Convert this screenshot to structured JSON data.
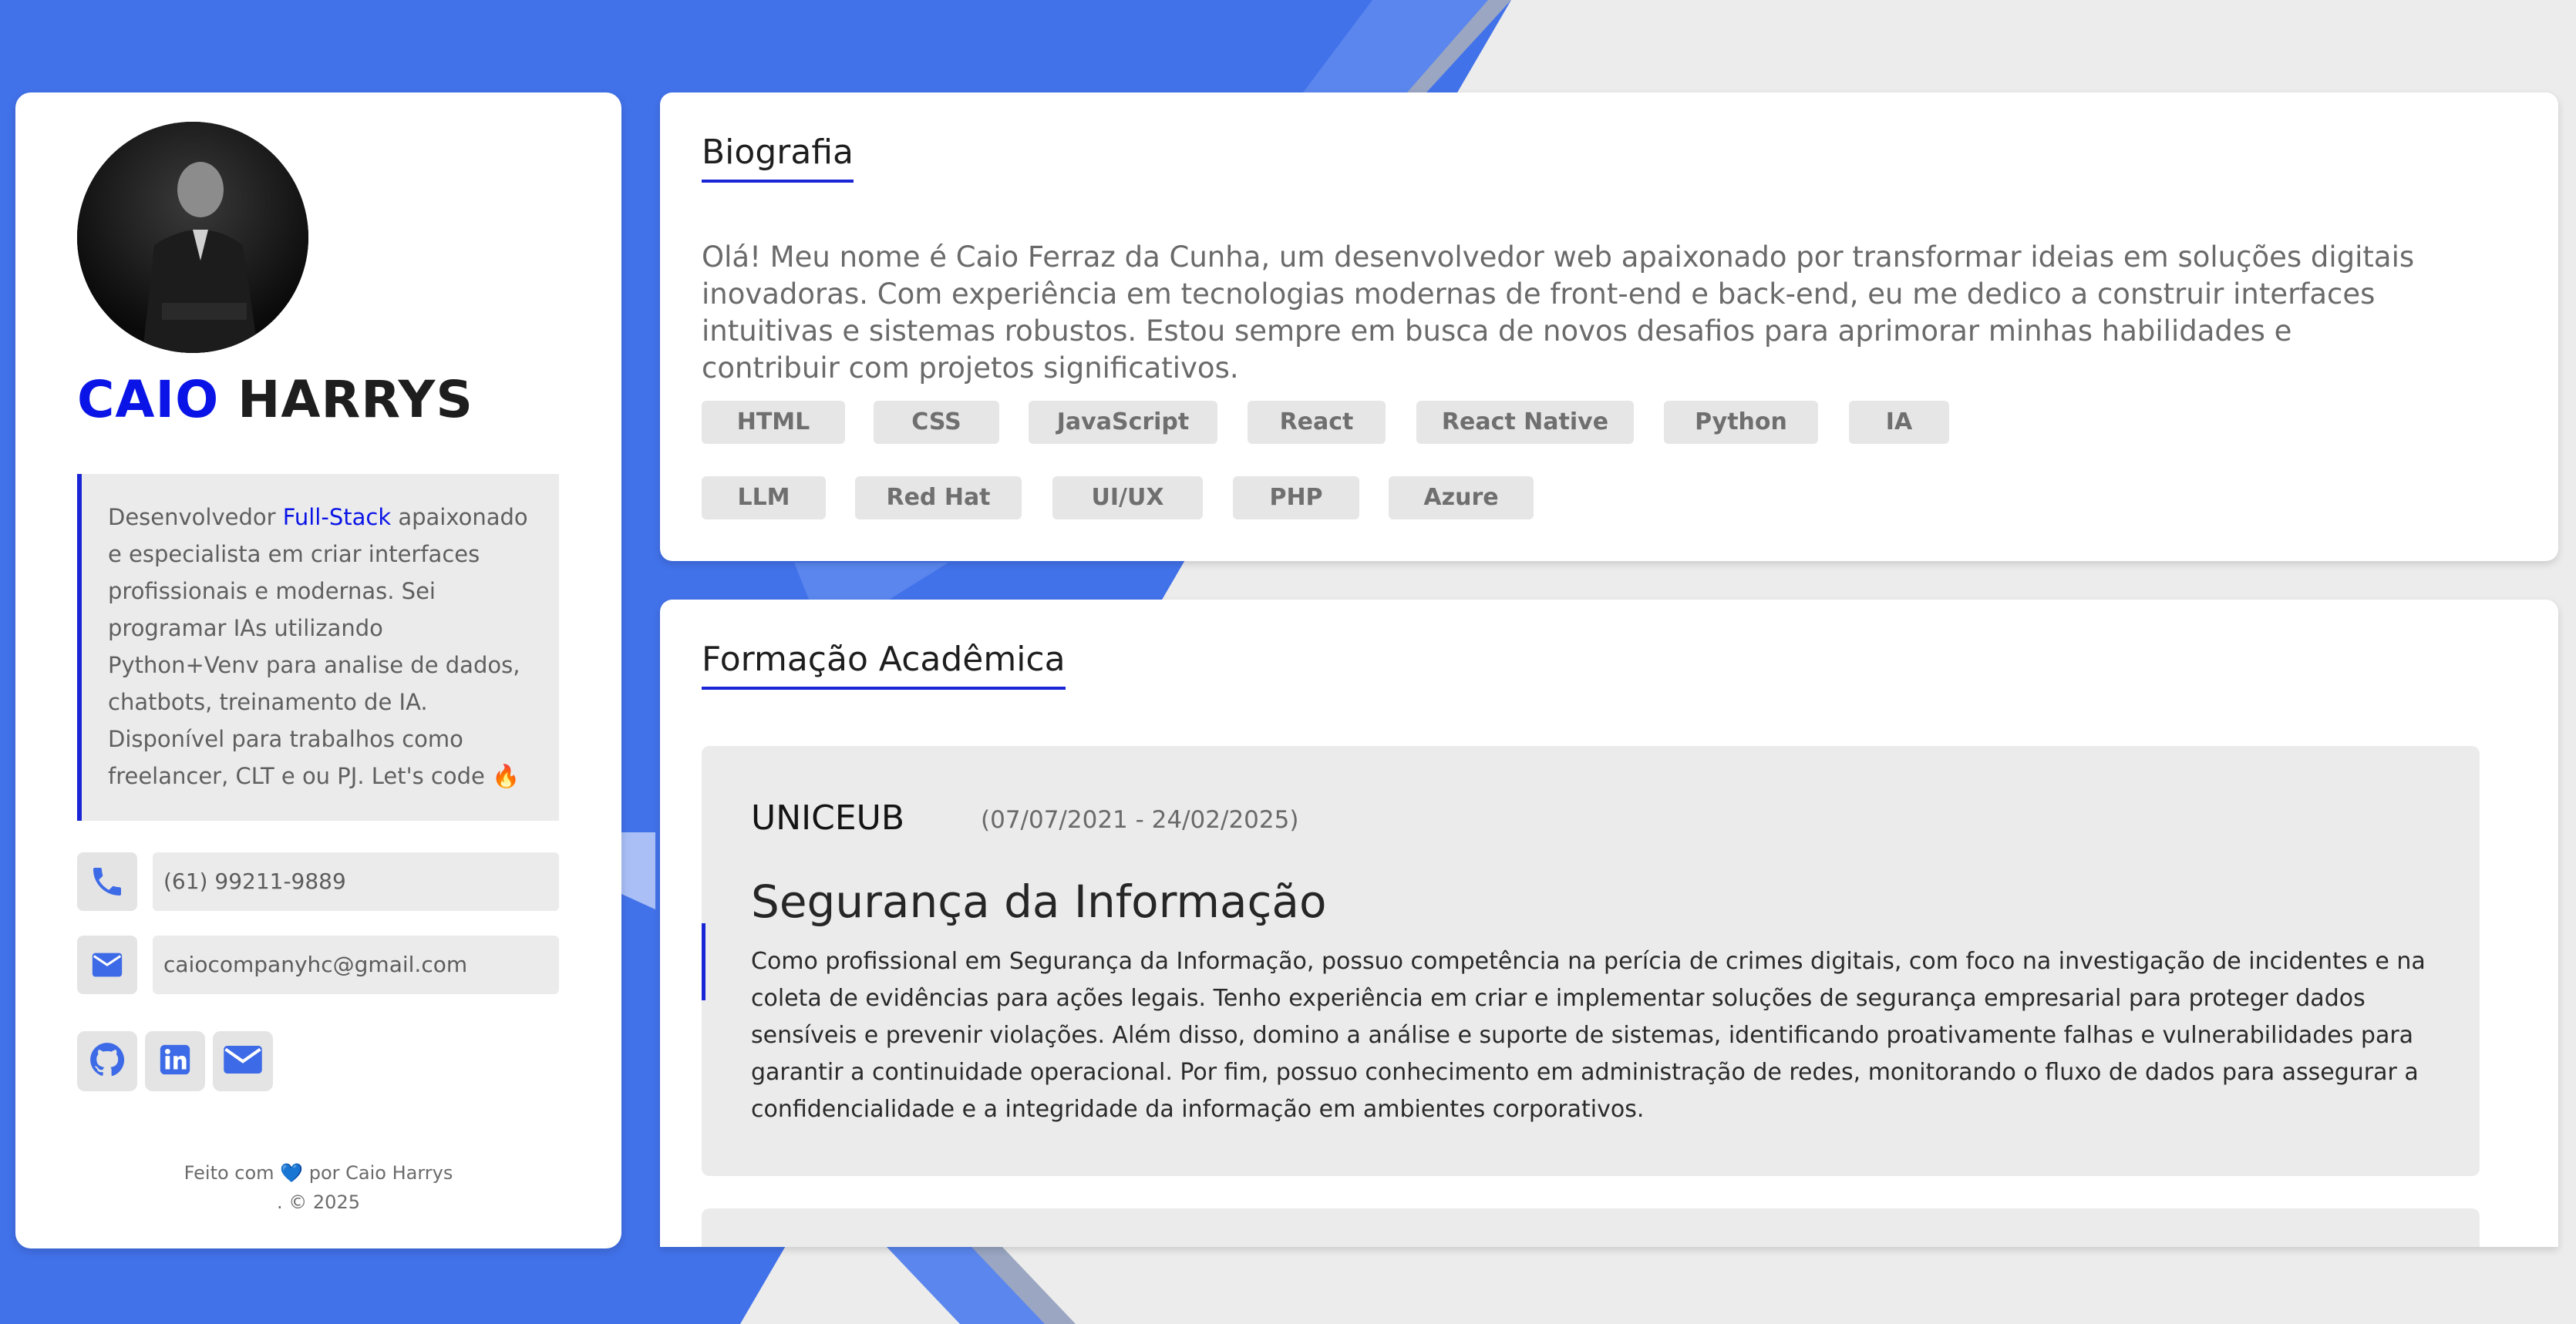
{
  "profile": {
    "first_name": "CAIO",
    "last_name": "HARRYS",
    "about_prefix": "Desenvolvedor ",
    "about_highlight": "Full-Stack",
    "about_rest": " apaixonado e especialista em criar interfaces profissionais e modernas. Sei programar IAs utilizando Python+Venv para analise de dados, chatbots, treinamento de IA. Disponível para trabalhos como freelancer, CLT e ou PJ. Let's code 🔥",
    "phone": "(61) 99211-9889",
    "email": "caiocompanyhc@gmail.com",
    "social_icons": [
      "github-icon",
      "linkedin-icon",
      "mail-icon"
    ],
    "footer_line1": "Feito com 💙 por Caio Harrys",
    "footer_line2": ". © 2025"
  },
  "biography": {
    "title": "Biografia",
    "text": "Olá! Meu nome é Caio Ferraz da Cunha, um desenvolvedor web apaixonado por transformar ideias em soluções digitais inovadoras. Com experiência em tecnologias modernas de front-end e back-end, eu me dedico a construir interfaces intuitivas e sistemas robustos. Estou sempre em busca de novos desafios para aprimorar minhas habilidades e contribuir com projetos significativos.",
    "skills": [
      "HTML",
      "CSS",
      "JavaScript",
      "React",
      "React Native",
      "Python",
      "IA",
      "LLM",
      "Red Hat",
      "UI/UX",
      "PHP",
      "Azure"
    ]
  },
  "education": {
    "title": "Formação Acadêmica",
    "items": [
      {
        "institution": "UNICEUB",
        "dates": "(07/07/2021 - 24/02/2025)",
        "course": "Segurança da Informação",
        "description": "Como profissional em Segurança da Informação, possuo competência na perícia de crimes digitais, com foco na investigação de incidentes e na coleta de evidências para ações legais. Tenho experiência em criar e implementar soluções de segurança empresarial para proteger dados sensíveis e prevenir violações. Além disso, domino a análise e suporte de sistemas, identificando proativamente falhas e vulnerabilidades para garantir a continuidade operacional. Por fim, possuo conhecimento em administração de redes, monitorando o fluxo de dados para assegurar a confidencialidade e a integridade da informação em ambientes corporativos."
      }
    ]
  },
  "colors": {
    "accent": "#0a14e6",
    "background_blue": "#4272ea",
    "card": "#ffffff",
    "panel": "#ebebeb"
  }
}
